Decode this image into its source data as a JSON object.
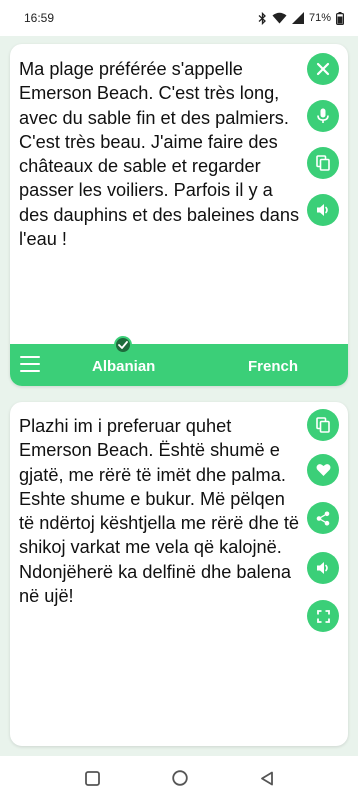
{
  "status_bar": {
    "time": "16:59",
    "battery": "71%",
    "icons": [
      "bluetooth-icon",
      "wifi-icon",
      "signal-icon",
      "battery-icon"
    ]
  },
  "source": {
    "text": "Ma plage préférée s'appelle Emerson Beach. C'est très long, avec du sable fin et des palmiers. C'est très beau. J'aime faire des châteaux de sable et regarder passer les voiliers. Parfois il y a des dauphins et des baleines dans l'eau !",
    "actions": [
      "close-icon",
      "microphone-icon",
      "copy-icon",
      "speaker-icon"
    ]
  },
  "language_bar": {
    "source_language": "Albanian",
    "target_language": "French",
    "icons": [
      "menu-icon",
      "check-icon"
    ]
  },
  "translation": {
    "text": "Plazhi im i preferuar quhet Emerson Beach. Është shumë e gjatë, me rërë të imët dhe palma. Eshte shume e bukur. Më pëlqen të ndërtoj kështjella me rërë dhe të shikoj varkat me vela që kalojnë. Ndonjëherë ka delfinë dhe balena në ujë!",
    "actions": [
      "copy-icon",
      "heart-icon",
      "share-icon",
      "speaker-icon",
      "fullscreen-icon"
    ]
  },
  "nav_bar": {
    "icons": [
      "recents-icon",
      "home-icon",
      "back-icon"
    ]
  },
  "colors": {
    "accent": "#3bcf78",
    "background": "#e9f3ec",
    "check_badge": "#1e6b3c"
  }
}
